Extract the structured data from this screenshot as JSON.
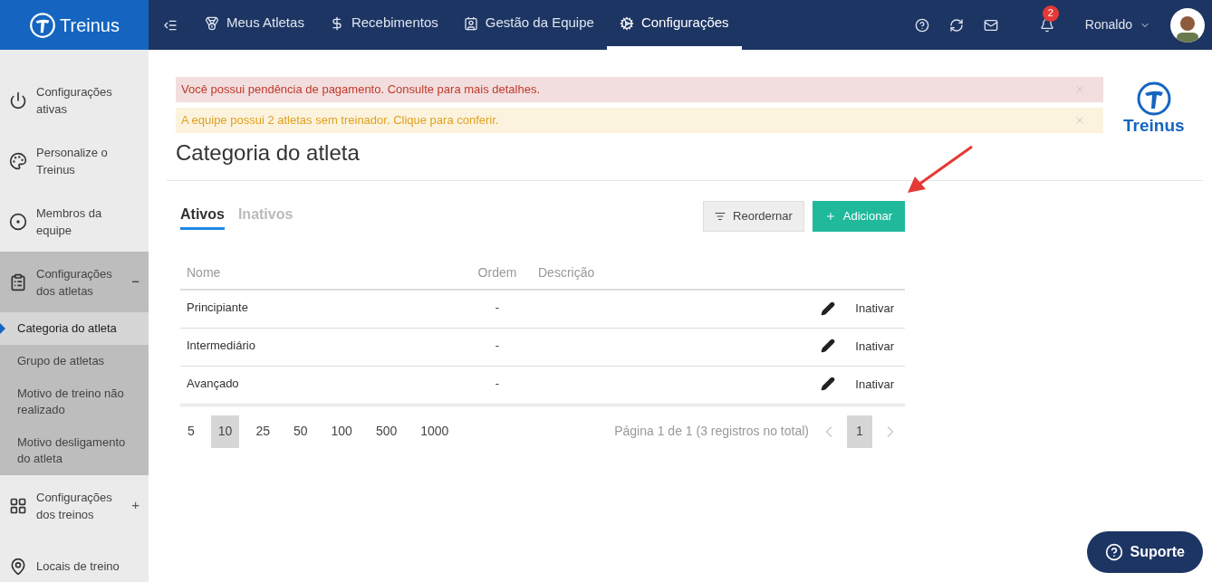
{
  "brand": {
    "name": "Treinus"
  },
  "nav": [
    {
      "label": "Meus Atletas",
      "selected": false
    },
    {
      "label": "Recebimentos",
      "selected": false
    },
    {
      "label": "Gestão da Equipe",
      "selected": false
    },
    {
      "label": "Configurações",
      "selected": true
    }
  ],
  "notifications": {
    "count": "2"
  },
  "user": {
    "name": "Ronaldo"
  },
  "sidebar": {
    "items": [
      {
        "label": "Configurações ativas"
      },
      {
        "label": "Personalize o Treinus"
      },
      {
        "label": "Membros da equipe"
      },
      {
        "label": "Configurações dos atletas",
        "toggle": "−",
        "expanded": true,
        "children": [
          {
            "label": "Categoria do atleta",
            "selected": true
          },
          {
            "label": "Grupo de atletas",
            "selected": false
          },
          {
            "label": "Motivo de treino não realizado",
            "selected": false
          },
          {
            "label": "Motivo desligamento do atleta",
            "selected": false
          }
        ]
      },
      {
        "label": "Configurações dos treinos",
        "toggle": "+",
        "expanded": false
      },
      {
        "label": "Locais de treino"
      }
    ]
  },
  "alerts": [
    {
      "kind": "danger",
      "text": "Você possui pendência de pagamento. Consulte para mais detalhes."
    },
    {
      "kind": "warning",
      "text": "A equipe possui 2 atletas sem treinador. Clique para conferir."
    }
  ],
  "page_title": "Categoria do atleta",
  "logo_text": "Treinus",
  "tabs": [
    {
      "label": "Ativos",
      "selected": true
    },
    {
      "label": "Inativos",
      "selected": false
    }
  ],
  "buttons": [
    {
      "kind": "reorder",
      "label": "Reordernar"
    },
    {
      "kind": "add",
      "label": "Adicionar"
    }
  ],
  "table": {
    "columns": [
      "Nome",
      "Ordem",
      "Descrição"
    ],
    "rows": [
      {
        "nome": "Principiante",
        "ordem": "-",
        "action": "Inativar"
      },
      {
        "nome": "Intermediário",
        "ordem": "-",
        "action": "Inativar"
      },
      {
        "nome": "Avançado",
        "ordem": "-",
        "action": "Inativar"
      }
    ]
  },
  "pagination": {
    "page_sizes": [
      {
        "label": "5",
        "selected": false
      },
      {
        "label": "10",
        "selected": true
      },
      {
        "label": "25",
        "selected": false
      },
      {
        "label": "50",
        "selected": false
      },
      {
        "label": "100",
        "selected": false
      },
      {
        "label": "500",
        "selected": false
      },
      {
        "label": "1000",
        "selected": false
      }
    ],
    "info": "Página 1 de 1 (3 registros no total)",
    "pages": [
      {
        "label": "1",
        "selected": true
      }
    ]
  },
  "support": {
    "label": "Suporte"
  }
}
